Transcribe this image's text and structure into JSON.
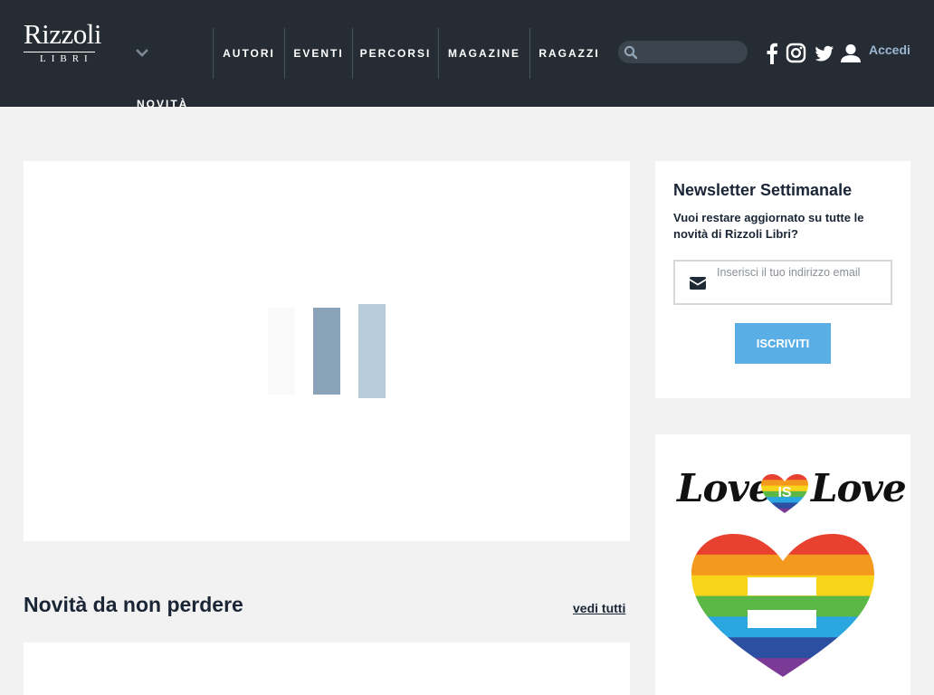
{
  "header": {
    "logo": {
      "name": "Rizzoli",
      "sub": "LIBRI"
    },
    "menu_label": "NOVITÀ",
    "nav": [
      {
        "label": "AUTORI"
      },
      {
        "label": "EVENTI"
      },
      {
        "label": "PERCORSI"
      },
      {
        "label": "MAGAZINE"
      },
      {
        "label": "RAGAZZI"
      }
    ],
    "search": {
      "placeholder": "",
      "icon": "search-icon"
    },
    "social": [
      "facebook-icon",
      "instagram-icon",
      "twitter-icon",
      "user-icon"
    ],
    "login_label": "Accedi"
  },
  "hero": {
    "loader_colors": [
      "#fafafa",
      "#8aa3b8",
      "#b8cddc"
    ]
  },
  "section": {
    "title": "Novità da non perdere",
    "view_all": "vedi tutti"
  },
  "newsletter": {
    "title": "Newsletter Settimanale",
    "text": "Vuoi restare aggiornato su tutte le novità di Rizzoli Libri?",
    "email_placeholder": "Inserisci il tuo indirizzo email",
    "button_label": "ISCRIVITI",
    "button_color": "#5aaee6"
  },
  "promo": {
    "word_left": "Love",
    "word_middle": "IS",
    "word_right": "Love",
    "rainbow": [
      "#e8412f",
      "#f39a1e",
      "#f7d31a",
      "#5bb847",
      "#2aa7e0",
      "#2c4fa2",
      "#7a3a95"
    ]
  },
  "colors": {
    "header_bg": "#262c33",
    "page_bg": "#f2f2f2",
    "accent": "#9ab6d2",
    "text": "#1a2535"
  }
}
